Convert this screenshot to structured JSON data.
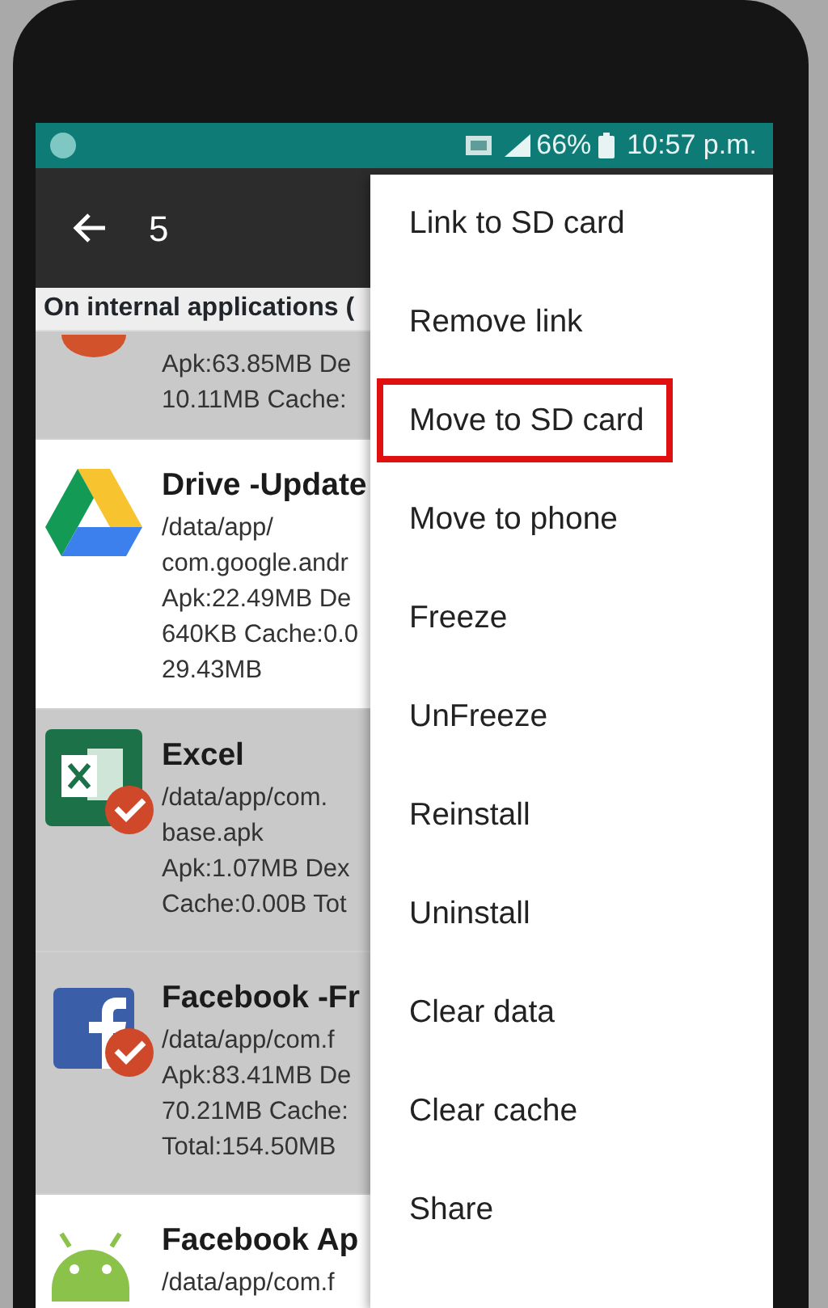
{
  "status_bar": {
    "battery": "66%",
    "time": "10:57 p.m."
  },
  "app_bar": {
    "title": "5"
  },
  "section_header": "On internal applications (",
  "apps": [
    {
      "lines": [
        "Apk:63.85MB De",
        "10.11MB Cache:"
      ],
      "selected": true,
      "checked": false
    },
    {
      "name": "Drive -Update",
      "lines": [
        "/data/app/",
        "com.google.andr",
        "Apk:22.49MB De",
        "640KB Cache:0.0",
        "29.43MB"
      ],
      "selected": false,
      "checked": false
    },
    {
      "name": "Excel",
      "lines": [
        "/data/app/com.",
        "base.apk",
        "Apk:1.07MB Dex",
        "Cache:0.00B Tot"
      ],
      "selected": true,
      "checked": true
    },
    {
      "name": "Facebook -Fr",
      "lines": [
        "/data/app/com.f",
        "Apk:83.41MB De",
        "70.21MB Cache:",
        "Total:154.50MB"
      ],
      "selected": true,
      "checked": true
    },
    {
      "name": "Facebook Ap",
      "lines": [
        "/data/app/com.f"
      ],
      "selected": false,
      "checked": false
    }
  ],
  "menu": [
    {
      "label": "Link to SD card",
      "highlighted": false
    },
    {
      "label": "Remove link",
      "highlighted": false
    },
    {
      "label": "Move to SD card",
      "highlighted": true
    },
    {
      "label": "Move to phone",
      "highlighted": false
    },
    {
      "label": "Freeze",
      "highlighted": false
    },
    {
      "label": "UnFreeze",
      "highlighted": false
    },
    {
      "label": "Reinstall",
      "highlighted": false
    },
    {
      "label": "Uninstall",
      "highlighted": false
    },
    {
      "label": "Clear data",
      "highlighted": false
    },
    {
      "label": "Clear cache",
      "highlighted": false
    },
    {
      "label": "Share",
      "highlighted": false
    }
  ]
}
